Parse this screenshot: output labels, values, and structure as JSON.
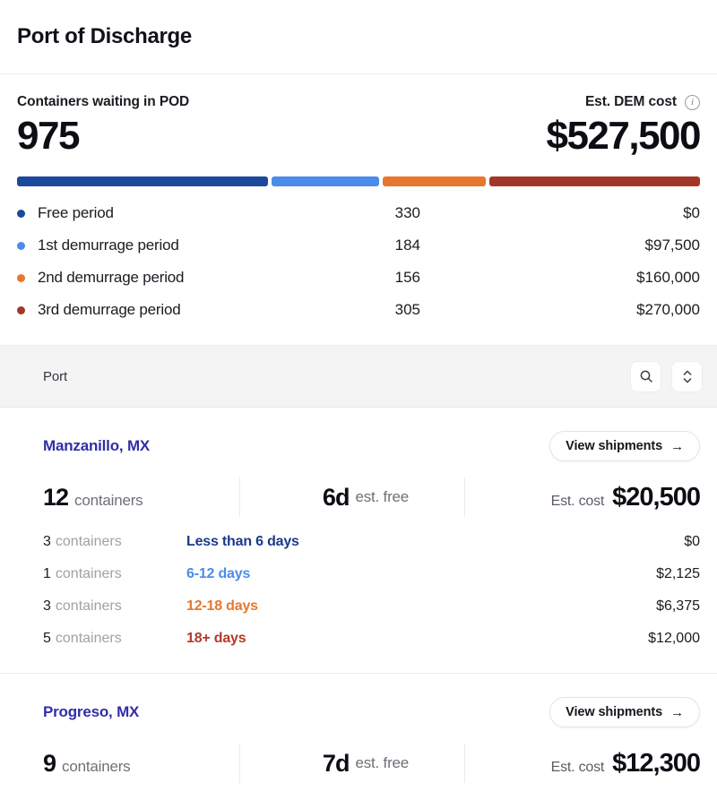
{
  "header": {
    "title": "Port of Discharge"
  },
  "summary": {
    "left_label": "Containers waiting in POD",
    "left_value": "975",
    "right_label": "Est. DEM cost",
    "right_value": "$527,500",
    "info_icon": "info-icon",
    "info_glyph": "i"
  },
  "chart_data": {
    "type": "bar",
    "title": "Containers waiting in POD by demurrage period",
    "total_containers": 975,
    "total_cost": "$527,500",
    "categories": [
      "Free period",
      "1st demurrage period",
      "2nd demurrage period",
      "3rd demurrage period"
    ],
    "values": [
      330,
      184,
      156,
      305
    ],
    "cost_labels": [
      "$0",
      "$97,500",
      "$160,000",
      "$270,000"
    ],
    "costs": [
      0,
      97500,
      160000,
      270000
    ],
    "colors": [
      "#1b4a9c",
      "#4a8ceb",
      "#e8762c",
      "#a33628"
    ],
    "legend": "inline-list",
    "xlabel": "",
    "ylabel": ""
  },
  "legend": [
    {
      "name": "Free period",
      "count": "330",
      "cost": "$0",
      "color": "#1b4a9c",
      "width_pct": 36.4
    },
    {
      "name": "1st demurrage period",
      "count": "184",
      "cost": "$97,500",
      "color": "#4a8ceb",
      "width_pct": 15.6
    },
    {
      "name": "2nd demurrage period",
      "count": "156",
      "cost": "$160,000",
      "color": "#e8762c",
      "width_pct": 14.9
    },
    {
      "name": "3rd demurrage period",
      "count": "305",
      "cost": "$270,000",
      "color": "#a33628",
      "width_pct": 30.6
    }
  ],
  "toolbar": {
    "column_label": "Port",
    "search_icon": "search-icon",
    "sort_icon": "sort-updown-icon"
  },
  "ports": [
    {
      "name": "Manzanillo, MX",
      "view_label": "View shipments",
      "view_arrow": "→",
      "containers": "12",
      "containers_unit": "containers",
      "free_days": "6d",
      "free_label": "est. free",
      "cost_prefix": "Est. cost",
      "cost": "$20,500",
      "rows": [
        {
          "count": "3",
          "unit": "containers",
          "label": "Less than 6 days",
          "cost": "$0",
          "color": "#1b3a8c"
        },
        {
          "count": "1",
          "unit": "containers",
          "label": "6-12 days",
          "cost": "$2,125",
          "color": "#4a8ceb"
        },
        {
          "count": "3",
          "unit": "containers",
          "label": "12-18 days",
          "cost": "$6,375",
          "color": "#e8762c"
        },
        {
          "count": "5",
          "unit": "containers",
          "label": "18+ days",
          "cost": "$12,000",
          "color": "#b03a2b"
        }
      ]
    },
    {
      "name": "Progreso, MX",
      "view_label": "View shipments",
      "view_arrow": "→",
      "containers": "9",
      "containers_unit": "containers",
      "free_days": "7d",
      "free_label": "est. free",
      "cost_prefix": "Est. cost",
      "cost": "$12,300",
      "rows": []
    }
  ]
}
